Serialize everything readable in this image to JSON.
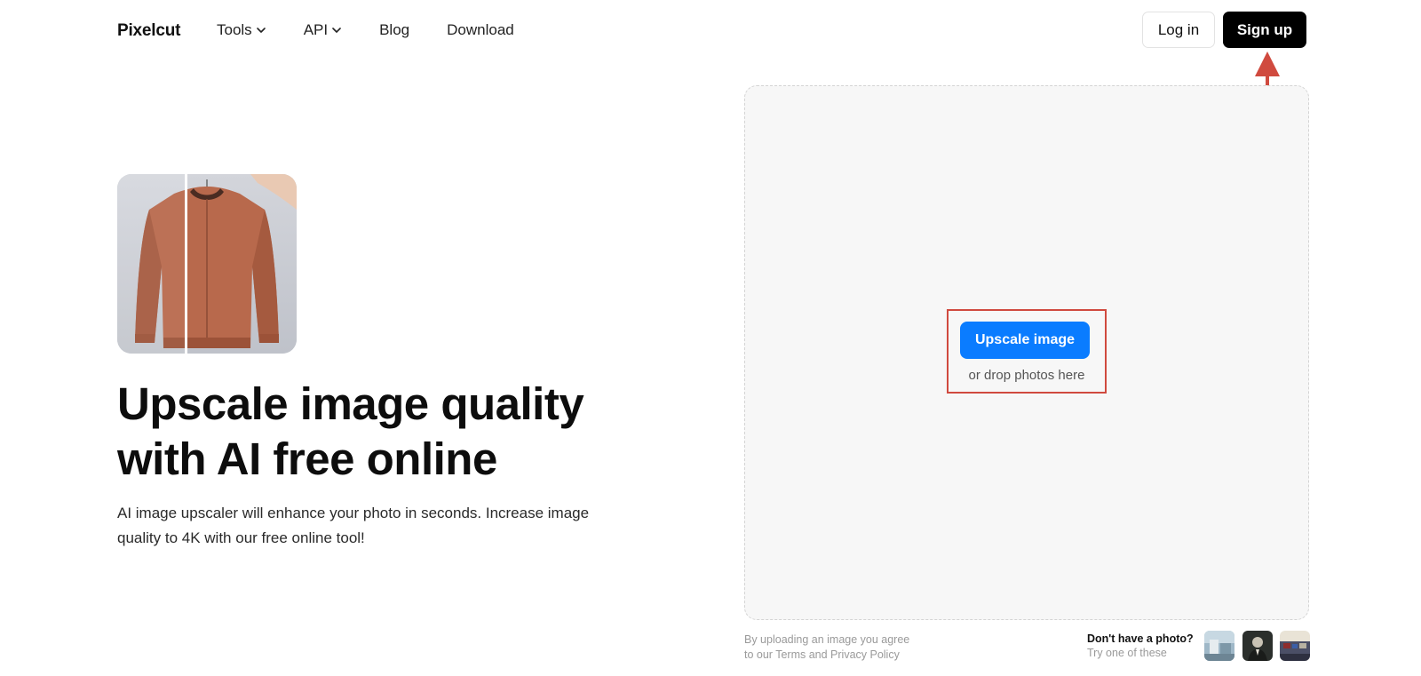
{
  "header": {
    "logo": "Pixelcut",
    "nav": [
      {
        "label": "Tools",
        "has_dropdown": true
      },
      {
        "label": "API",
        "has_dropdown": true
      },
      {
        "label": "Blog",
        "has_dropdown": false
      },
      {
        "label": "Download",
        "has_dropdown": false
      }
    ],
    "login_label": "Log in",
    "signup_label": "Sign up"
  },
  "hero": {
    "title_line1": "Upscale image quality",
    "title_line2": "with AI free online",
    "subtitle_line1": "AI image upscaler will enhance your photo in seconds. Increase image",
    "subtitle_line2": "quality to 4K with our free online tool!"
  },
  "upload": {
    "button_label": "Upscale image",
    "drop_text": "or drop photos here"
  },
  "footer": {
    "terms_line1": "By uploading an image you agree",
    "terms_line2": "to our Terms and Privacy Policy",
    "try_title": "Don't have a photo?",
    "try_sub": "Try one of these"
  },
  "colors": {
    "primary_blue": "#0a7cff",
    "signup_black": "#000000",
    "annotation_red": "#d04a3f",
    "dropzone_bg": "#f7f7f7"
  },
  "icons": {
    "dropdown": "chevron-down-icon",
    "annotation": "arrow-up-icon"
  }
}
